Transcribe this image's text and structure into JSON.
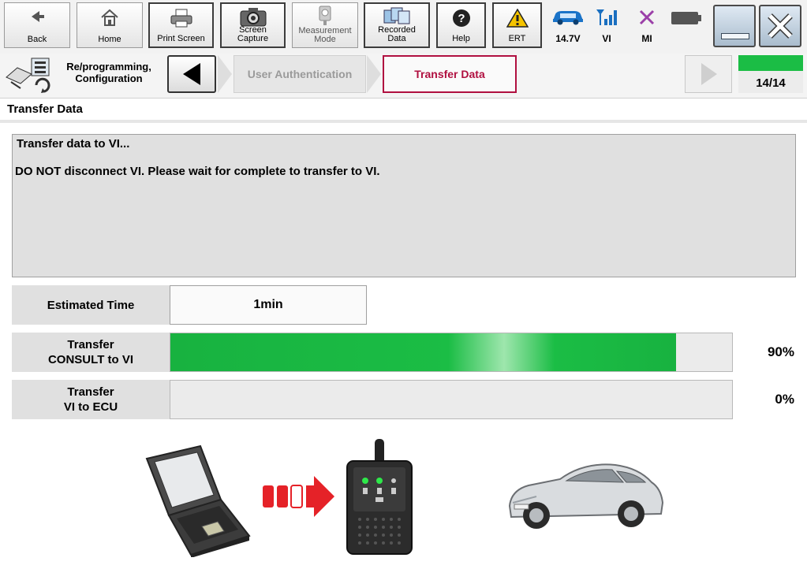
{
  "toolbar": {
    "back_label": "Back",
    "home_label": "Home",
    "print_label": "Print Screen",
    "capture_label_1": "Screen",
    "capture_label_2": "Capture",
    "measurement_label_1": "Measurement",
    "measurement_label_2": "Mode",
    "recorded_label_1": "Recorded",
    "recorded_label_2": "Data",
    "help_label": "Help",
    "ert_label": "ERT",
    "battery_voltage": "14.7V",
    "vi_label": "VI",
    "mi_label": "MI"
  },
  "nav": {
    "section_line1": "Re/programming,",
    "section_line2": "Configuration",
    "steps": [
      "User Authentication",
      "Transfer Data"
    ],
    "progress_text": "14/14",
    "progress_fraction": 1.0
  },
  "page": {
    "title": "Transfer Data",
    "message_line1": "Transfer data to VI...",
    "message_line2": "DO NOT disconnect VI. Please wait for complete to transfer to VI."
  },
  "estimated": {
    "label": "Estimated Time",
    "value": "1min"
  },
  "transfers": [
    {
      "label_line1": "Transfer",
      "label_line2": "CONSULT to VI",
      "percent_text": "90%",
      "percent": 90
    },
    {
      "label_line1": "Transfer",
      "label_line2": "VI to ECU",
      "percent_text": "0%",
      "percent": 0
    }
  ],
  "colors": {
    "progress_green": "#1bbd45",
    "active_step_text": "#b01040",
    "active_step_border": "#b01040"
  },
  "icons": [
    "back-arrow-icon",
    "home-icon",
    "printer-icon",
    "camera-icon",
    "gauge-icon",
    "recorded-data-icon",
    "help-icon",
    "warning-icon",
    "car-battery-icon",
    "signal-icon",
    "mi-x-icon",
    "battery-icon",
    "minimize-icon",
    "close-icon",
    "configuration-icon",
    "laptop-icon",
    "arrow-right-icon",
    "vi-device-icon",
    "car-icon"
  ]
}
